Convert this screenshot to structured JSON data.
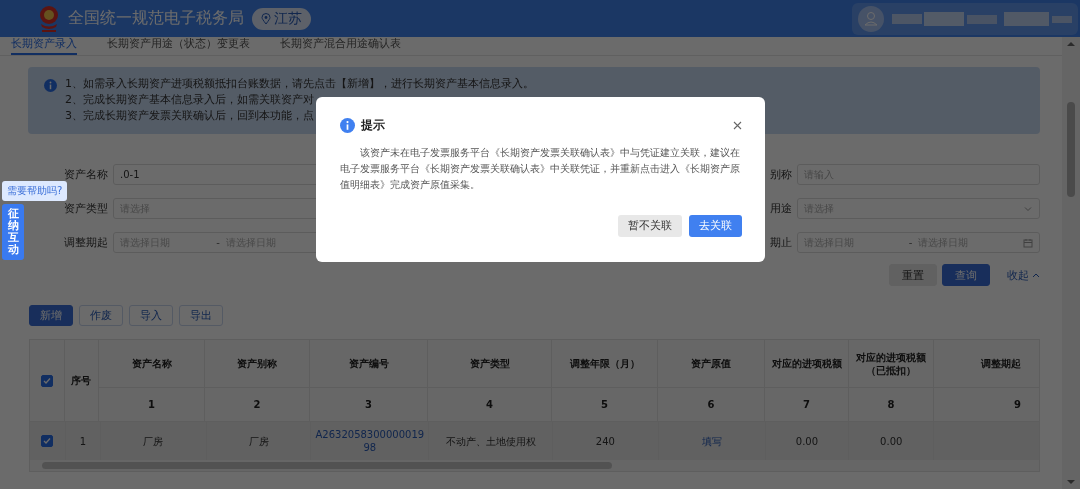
{
  "header": {
    "title": "全国统一规范电子税务局",
    "region": "江苏"
  },
  "tabs": [
    {
      "label": "长期资产录入",
      "selected": true
    },
    {
      "label": "长期资产用途（状态）变更表",
      "selected": false
    },
    {
      "label": "长期资产混合用途确认表",
      "selected": false
    }
  ],
  "notice": {
    "lines": [
      "1、如需录入长期资产进项税额抵扣台账数据，请先点击【新增】，进行长期资产基本信息录入。",
      "2、完成长期资产基本信息录入后，如需关联资产对",
      "3、完成长期资产发票关联确认后，回到本功能，点"
    ]
  },
  "form": {
    "left": [
      {
        "label": "资产名称",
        "kind": "text",
        "value": ".0-1"
      },
      {
        "label": "资产类型",
        "kind": "select",
        "placeholder": "请选择"
      },
      {
        "label": "调整期起",
        "kind": "daterange",
        "placeholder": "请选择日期",
        "separator": "-",
        "placeholder_end": "请选择日期"
      }
    ],
    "right": [
      {
        "label": "别称",
        "kind": "text",
        "placeholder": "请输入"
      },
      {
        "label": "用途",
        "kind": "select",
        "placeholder": "请选择"
      },
      {
        "label": "期止",
        "kind": "daterange",
        "placeholder": "请选择日期",
        "separator": "-",
        "placeholder_end": "请选择日期"
      }
    ]
  },
  "form_actions": [
    {
      "label": "重置",
      "kind": "default"
    },
    {
      "label": "查询",
      "kind": "primary"
    }
  ],
  "collapse": "收起",
  "toolbar": [
    {
      "label": "新增",
      "kind": "primary"
    },
    {
      "label": "作废",
      "kind": "default"
    },
    {
      "label": "导入",
      "kind": "default"
    },
    {
      "label": "导出",
      "kind": "default"
    }
  ],
  "table": {
    "all_selected": true,
    "columns": [
      {
        "title": "序号"
      },
      {
        "title": "资产名称",
        "number": "1"
      },
      {
        "title": "资产别称",
        "number": "2"
      },
      {
        "title": "资产编号",
        "number": "3"
      },
      {
        "title": "资产类型",
        "number": "4"
      },
      {
        "title": "调整年限（月）",
        "number": "5"
      },
      {
        "title": "资产原值",
        "number": "6"
      },
      {
        "title": "对应的进项税额",
        "number": "7"
      },
      {
        "title": "对应的进项税额（已抵扣）",
        "number": "8"
      },
      {
        "title": "调整期起",
        "number": "9"
      }
    ],
    "rows": [
      {
        "selected": true,
        "cells": [
          {
            "text": "1",
            "kind": "text"
          },
          {
            "text": "厂房",
            "kind": "text"
          },
          {
            "text": "厂房",
            "kind": "text"
          },
          {
            "text": "A263205830000001998",
            "kind": "link"
          },
          {
            "text": "不动产、土地使用权",
            "kind": "text"
          },
          {
            "text": "240",
            "kind": "text"
          },
          {
            "text": "填写",
            "kind": "link"
          },
          {
            "text": "0.00",
            "kind": "text"
          },
          {
            "text": "0.00",
            "kind": "text"
          }
        ]
      }
    ]
  },
  "help": {
    "bubble": "需要帮助吗?",
    "widget": "征纳互动"
  },
  "dialog": {
    "title": "提示",
    "message": "该资产未在电子发票服务平台《长期资产发票关联确认表》中与凭证建立关联，建议在电子发票服务平台《长期资产发票关联确认表》中关联凭证，并重新点击进入《长期资产原值明细表》完成资产原值采集。",
    "buttons": [
      {
        "label": "暂不关联",
        "kind": "default"
      },
      {
        "label": "去关联",
        "kind": "primary"
      }
    ]
  }
}
